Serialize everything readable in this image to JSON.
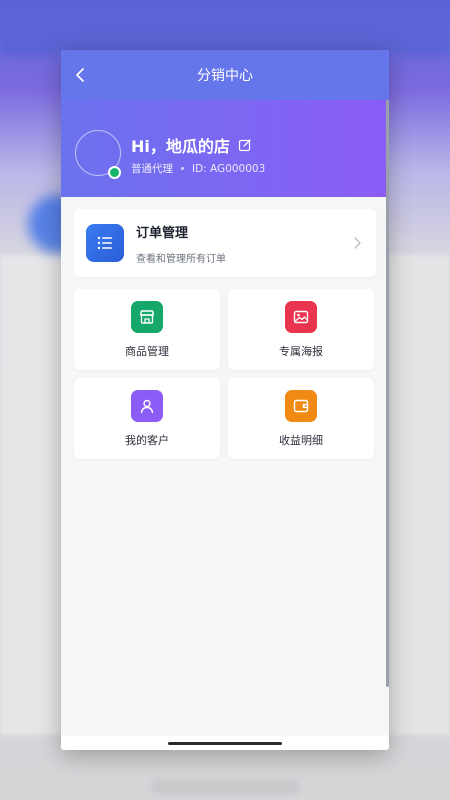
{
  "nav": {
    "title": "分销中心"
  },
  "profile": {
    "greeting": "Hi，地瓜的店",
    "role": "普通代理",
    "id_text": "ID: AG000003"
  },
  "order": {
    "title": "订单管理",
    "desc": "查看和管理所有订单"
  },
  "tiles": [
    {
      "label": "商品管理",
      "icon": "store-icon",
      "color": "#16a86a"
    },
    {
      "label": "专属海报",
      "icon": "image-icon",
      "color": "#e8344e"
    },
    {
      "label": "我的客户",
      "icon": "user-icon",
      "color": "#8b5cf6"
    },
    {
      "label": "收益明细",
      "icon": "wallet-icon",
      "color": "#f08a12"
    }
  ],
  "colors": {
    "nav": "#6575ea",
    "hero_start": "#6b72ee",
    "hero_end": "#8b5cf6",
    "order_icon": "#2f6be6",
    "online": "#16b36b"
  }
}
